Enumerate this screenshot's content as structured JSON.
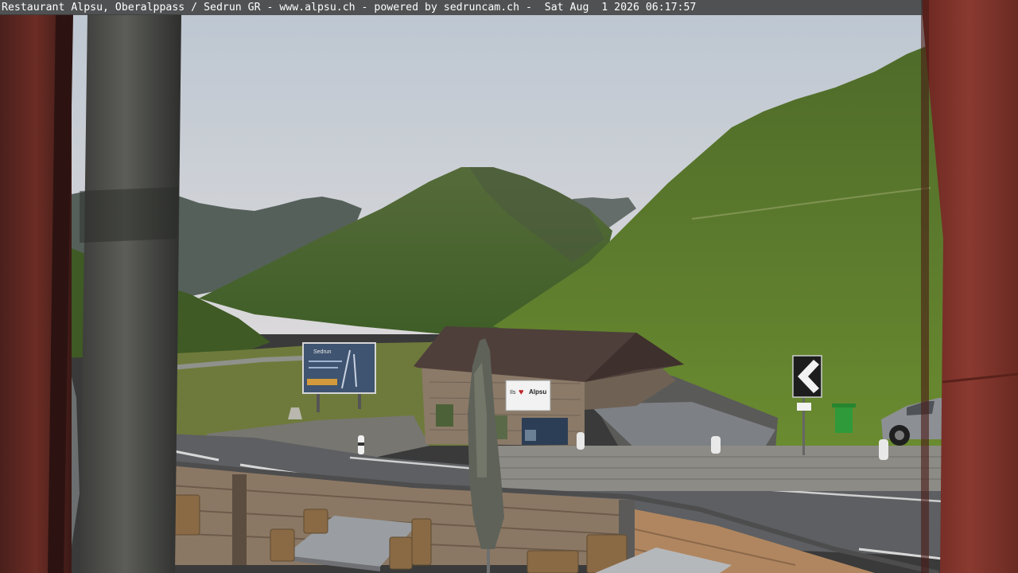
{
  "overlay": {
    "caption": "Restaurant Alpsu, Oberalppass / Sedrun GR - www.alpsu.ch - powered by sedruncam.ch -  Sat Aug  1 2026 06:17:57"
  },
  "scene": {
    "building_sign_prefix": "Ils",
    "building_sign_name": "Alpsu",
    "billboard_title": "Sedrun",
    "colors": {
      "sky_top": "#b9c3cf",
      "sky_bottom": "#d9d9dc",
      "grass": "#5f7a2c",
      "mountain_far": "#4f5b53",
      "frame_red": "#7a2e26"
    }
  }
}
